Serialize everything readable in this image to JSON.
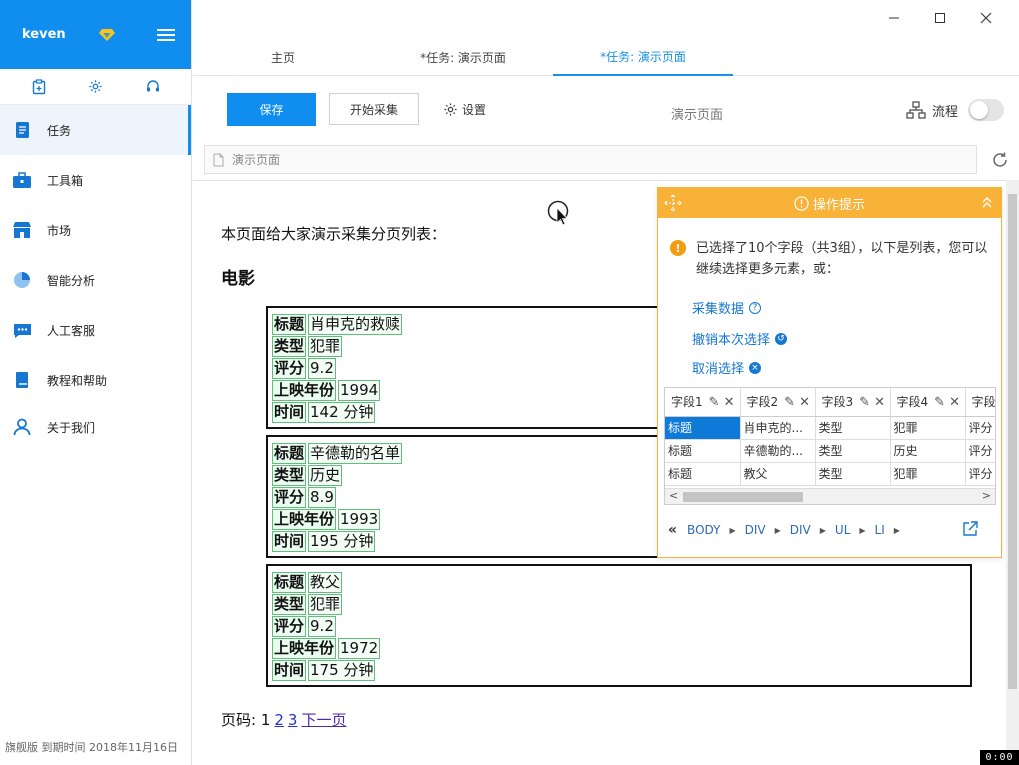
{
  "sidebar": {
    "user": "keven",
    "items": [
      {
        "label": "任务",
        "icon": "task-icon"
      },
      {
        "label": "工具箱",
        "icon": "toolbox-icon"
      },
      {
        "label": "市场",
        "icon": "market-icon"
      },
      {
        "label": "智能分析",
        "icon": "pie-chart-icon"
      },
      {
        "label": "人工客服",
        "icon": "chat-icon"
      },
      {
        "label": "教程和帮助",
        "icon": "book-icon"
      },
      {
        "label": "关于我们",
        "icon": "user-icon"
      }
    ],
    "footer": "旗舰版  到期时间 2018年11月16日"
  },
  "tabs": [
    {
      "label": "主页"
    },
    {
      "label": "*任务: 演示页面"
    },
    {
      "label": "*任务: 演示页面"
    }
  ],
  "toolbar": {
    "save_label": "保存",
    "start_label": "开始采集",
    "settings_label": "设置",
    "page_name": "演示页面",
    "flow_label": "流程"
  },
  "urlbar": {
    "text": "演示页面"
  },
  "page": {
    "intro": "本页面给大家演示采集分页列表：",
    "heading": "电影",
    "movies": [
      {
        "fields": [
          [
            "标题",
            "肖申克的救赎"
          ],
          [
            "类型",
            "犯罪"
          ],
          [
            "评分",
            "9.2"
          ],
          [
            "上映年份",
            "1994"
          ],
          [
            "时间",
            "142 分钟"
          ]
        ]
      },
      {
        "fields": [
          [
            "标题",
            "辛德勒的名单"
          ],
          [
            "类型",
            "历史"
          ],
          [
            "评分",
            "8.9"
          ],
          [
            "上映年份",
            "1993"
          ],
          [
            "时间",
            "195 分钟"
          ]
        ]
      },
      {
        "fields": [
          [
            "标题",
            "教父"
          ],
          [
            "类型",
            "犯罪"
          ],
          [
            "评分",
            "9.2"
          ],
          [
            "上映年份",
            "1972"
          ],
          [
            "时间",
            "175 分钟"
          ]
        ]
      }
    ],
    "pager": {
      "label": "页码: 1",
      "page2": "2",
      "page3": "3",
      "next": "下一页"
    }
  },
  "hint": {
    "title": "操作提示",
    "message": "已选择了10个字段（共3组），以下是列表，您可以继续选择更多元素，或：",
    "links": [
      "采集数据",
      "撤销本次选择",
      "取消选择"
    ],
    "columns": [
      "字段1",
      "字段2",
      "字段3",
      "字段4",
      "字段"
    ],
    "rows": [
      [
        "标题",
        "肖申克的...",
        "类型",
        "犯罪",
        "评分"
      ],
      [
        "标题",
        "辛德勒的...",
        "类型",
        "历史",
        "评分"
      ],
      [
        "标题",
        "教父",
        "类型",
        "犯罪",
        "评分"
      ]
    ],
    "breadcrumbs": [
      "BODY",
      "DIV",
      "DIV",
      "UL",
      "LI"
    ]
  },
  "timecode": "0:00"
}
